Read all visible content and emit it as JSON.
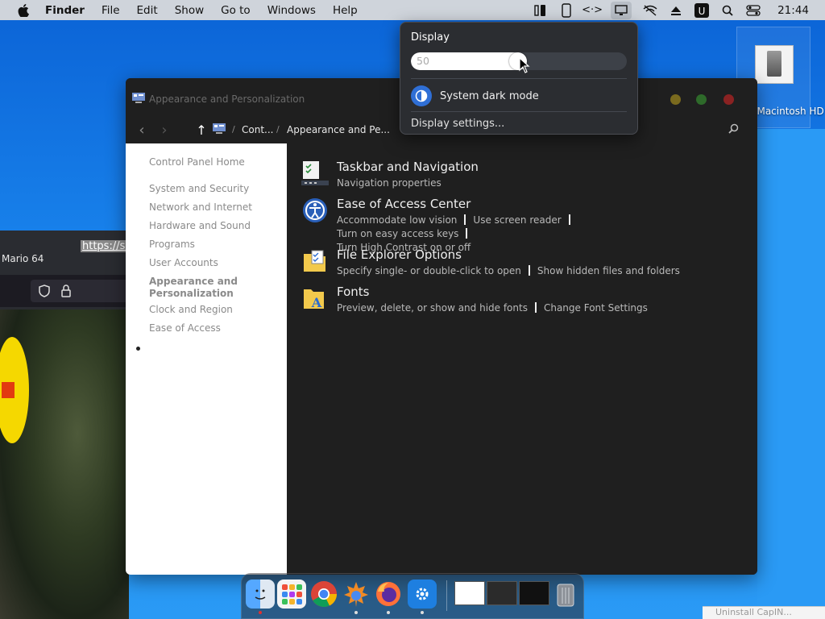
{
  "menubar": {
    "items": [
      "Finder",
      "File",
      "Edit",
      "Show",
      "Go to",
      "Windows",
      "Help"
    ],
    "clock": "21:44"
  },
  "desktop": {
    "hd_label": "led Macintosh HD"
  },
  "browser": {
    "title": "Mario 64",
    "url": "https://si"
  },
  "control_panel": {
    "window_title": "Appearance and Personalization",
    "breadcrumb": [
      "Cont...",
      "Appearance and Pe..."
    ],
    "sidebar": {
      "home": "Control Panel Home",
      "items": [
        "System and Security",
        "Network and Internet",
        "Hardware and Sound",
        "Programs",
        "User Accounts",
        "Appearance and Personalization",
        "Clock and Region",
        "Ease of Access"
      ]
    },
    "categories": [
      {
        "heading": "Taskbar and Navigation",
        "links": [
          "Navigation properties"
        ]
      },
      {
        "heading": "Ease of Access Center",
        "links": [
          "Accommodate low vision",
          "Use screen reader",
          "Turn on easy access keys",
          "Turn High Contrast on or off"
        ]
      },
      {
        "heading": "File Explorer Options",
        "links": [
          "Specify single- or double-click to open",
          "Show hidden files and folders"
        ]
      },
      {
        "heading": "Fonts",
        "links": [
          "Preview, delete, or show and hide fonts",
          "Change Font Settings"
        ]
      }
    ]
  },
  "display_popover": {
    "title": "Display",
    "brightness_value": "50",
    "brightness_fraction": 0.5,
    "dark_mode_label": "System dark mode",
    "settings_link": "Display settings..."
  },
  "corner_note": "Uninstall CapIN..."
}
